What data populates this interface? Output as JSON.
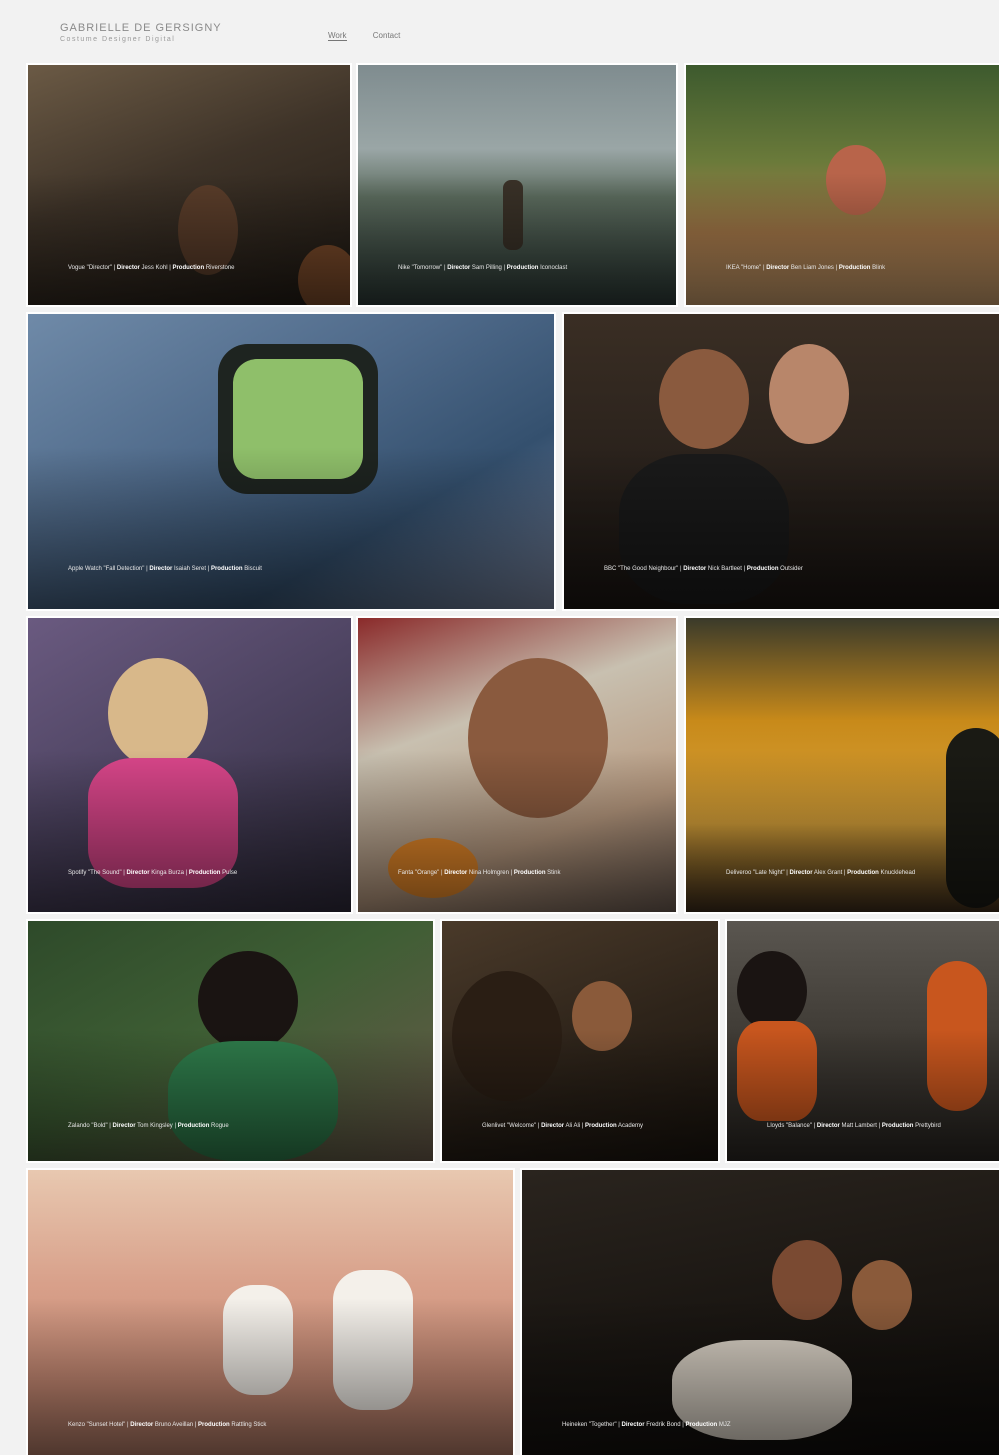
{
  "header": {
    "brand_name": "GABRIELLE DE GERSIGNY",
    "brand_sub": "Costume Designer Digital",
    "nav": [
      {
        "label": "Work",
        "active": true
      },
      {
        "label": "Contact",
        "active": false
      }
    ]
  },
  "tiles": [
    {
      "id": "t1",
      "cap1": "Vogue \"Director\"",
      "dir_label": "Director",
      "dir": "Jess Kohl",
      "prod_label": "Production",
      "prod": "Riverstone"
    },
    {
      "id": "t2",
      "cap1": "Nike \"Tomorrow\"",
      "dir_label": "Director",
      "dir": "Sam Pilling",
      "prod_label": "Production",
      "prod": "Iconoclast"
    },
    {
      "id": "t3",
      "cap1": "IKEA \"Home\"",
      "dir_label": "Director",
      "dir": "Ben Liam Jones",
      "prod_label": "Production",
      "prod": "Blink"
    },
    {
      "id": "t4",
      "cap1": "Apple Watch \"Fall Detection\"",
      "dir_label": "Director",
      "dir": "Isaiah Seret",
      "prod_label": "Production",
      "prod": "Biscuit"
    },
    {
      "id": "t5",
      "cap1": "BBC \"The Good Neighbour\"",
      "dir_label": "Director",
      "dir": "Nick Bartleet",
      "prod_label": "Production",
      "prod": "Outsider"
    },
    {
      "id": "t6",
      "cap1": "Spotify \"The Sound\"",
      "dir_label": "Director",
      "dir": "Kinga Burza",
      "prod_label": "Production",
      "prod": "Pulse"
    },
    {
      "id": "t7",
      "cap1": "Fanta \"Orange\"",
      "dir_label": "Director",
      "dir": "Nina Holmgren",
      "prod_label": "Production",
      "prod": "Stink"
    },
    {
      "id": "t8",
      "cap1": "Deliveroo \"Late Night\"",
      "dir_label": "Director",
      "dir": "Alex Grant",
      "prod_label": "Production",
      "prod": "Knucklehead"
    },
    {
      "id": "t9",
      "cap1": "Zalando \"Bold\"",
      "dir_label": "Director",
      "dir": "Tom Kingsley",
      "prod_label": "Production",
      "prod": "Rogue"
    },
    {
      "id": "t10",
      "cap1": "Glenlivet \"Welcome\"",
      "dir_label": "Director",
      "dir": "Ali Ali",
      "prod_label": "Production",
      "prod": "Academy"
    },
    {
      "id": "t11",
      "cap1": "Lloyds \"Balance\"",
      "dir_label": "Director",
      "dir": "Matt Lambert",
      "prod_label": "Production",
      "prod": "Prettybird"
    },
    {
      "id": "t12",
      "cap1": "Kenzo \"Sunset Hotel\"",
      "dir_label": "Director",
      "dir": "Bruno Aveillan",
      "prod_label": "Production",
      "prod": "Rattling Stick"
    },
    {
      "id": "t13",
      "cap1": "Heineken \"Together\"",
      "dir_label": "Director",
      "dir": "Fredrik Bond",
      "prod_label": "Production",
      "prod": "MJZ"
    }
  ]
}
